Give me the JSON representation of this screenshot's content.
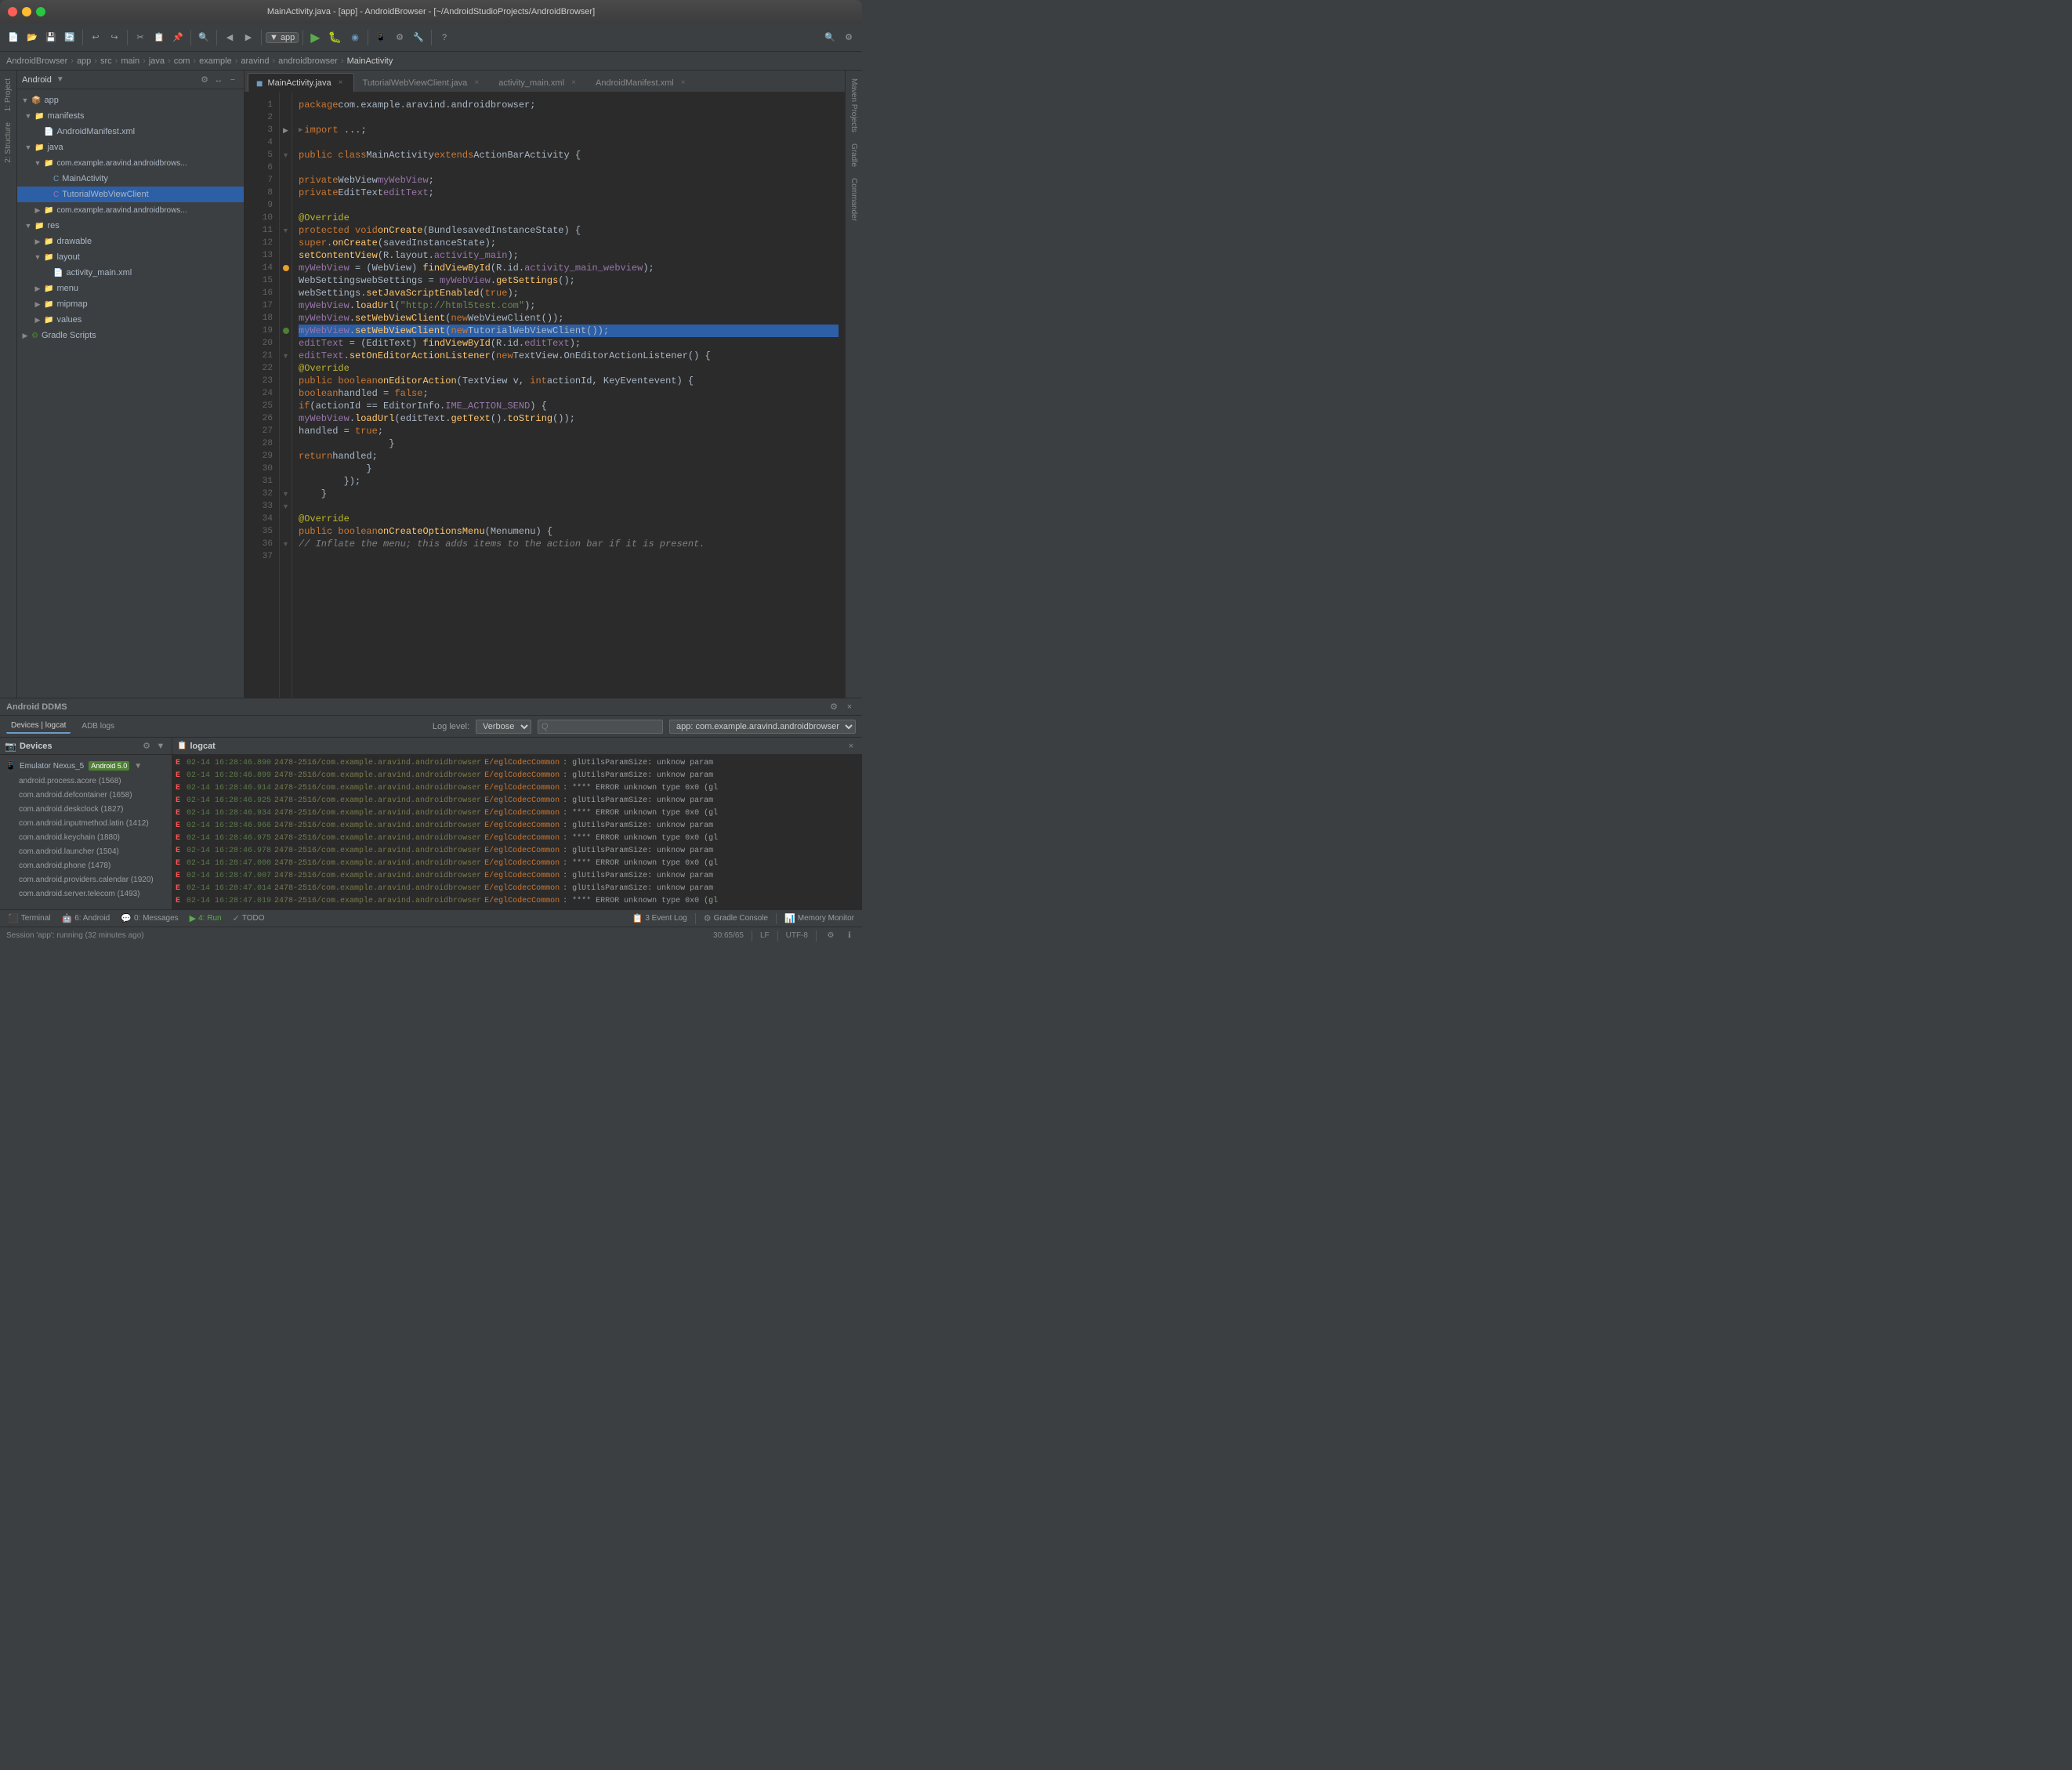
{
  "window": {
    "title": "MainActivity.java - [app] - AndroidBrowser - [~/AndroidStudioProjects/AndroidBrowser]"
  },
  "breadcrumb": {
    "items": [
      "AndroidBrowser",
      "app",
      "src",
      "main",
      "java",
      "com",
      "example",
      "aravind",
      "androidbrowser",
      "MainActivity"
    ]
  },
  "tabs": [
    {
      "label": "MainActivity.java",
      "active": true,
      "modified": true
    },
    {
      "label": "TutorialWebViewClient.java",
      "active": false
    },
    {
      "label": "activity_main.xml",
      "active": false
    },
    {
      "label": "AndroidManifest.xml",
      "active": false
    }
  ],
  "project_panel": {
    "title": "Android",
    "items": [
      {
        "level": 0,
        "label": "app",
        "type": "folder",
        "expanded": true
      },
      {
        "level": 1,
        "label": "manifests",
        "type": "folder",
        "expanded": true
      },
      {
        "level": 2,
        "label": "AndroidManifest.xml",
        "type": "xml"
      },
      {
        "level": 1,
        "label": "java",
        "type": "folder",
        "expanded": true
      },
      {
        "level": 2,
        "label": "com.example.aravind.androidbrows...",
        "type": "folder",
        "expanded": true
      },
      {
        "level": 3,
        "label": "MainActivity",
        "type": "java",
        "selected": false
      },
      {
        "level": 3,
        "label": "TutorialWebViewClient",
        "type": "java_c",
        "selected": true
      },
      {
        "level": 2,
        "label": "com.example.aravind.androidbrows...",
        "type": "folder"
      },
      {
        "level": 1,
        "label": "res",
        "type": "folder",
        "expanded": true
      },
      {
        "level": 2,
        "label": "drawable",
        "type": "folder"
      },
      {
        "level": 2,
        "label": "layout",
        "type": "folder",
        "expanded": true
      },
      {
        "level": 3,
        "label": "activity_main.xml",
        "type": "xml"
      },
      {
        "level": 2,
        "label": "menu",
        "type": "folder"
      },
      {
        "level": 2,
        "label": "mipmap",
        "type": "folder"
      },
      {
        "level": 2,
        "label": "values",
        "type": "folder"
      },
      {
        "level": 0,
        "label": "Gradle Scripts",
        "type": "gradle"
      }
    ]
  },
  "code": {
    "lines": [
      {
        "num": "",
        "content": "package com.example.aravind.androidbrowser;"
      },
      {
        "num": "",
        "content": ""
      },
      {
        "num": "",
        "content": "import ...;"
      },
      {
        "num": "",
        "content": ""
      },
      {
        "num": "",
        "content": "public class MainActivity extends ActionBarActivity {"
      },
      {
        "num": "",
        "content": ""
      },
      {
        "num": "",
        "content": "    private WebView myWebView;"
      },
      {
        "num": "",
        "content": "    private EditText editText;"
      },
      {
        "num": "",
        "content": ""
      },
      {
        "num": "",
        "content": "    @Override"
      },
      {
        "num": "",
        "content": "    protected void onCreate(Bundle savedInstanceState) {"
      },
      {
        "num": "",
        "content": "        super.onCreate(savedInstanceState);"
      },
      {
        "num": "",
        "content": "        setContentView(R.layout.activity_main);"
      },
      {
        "num": "",
        "content": "        myWebView = (WebView) findViewById(R.id.activity_main_webview);"
      },
      {
        "num": "",
        "content": "        WebSettings webSettings = myWebView.getSettings();"
      },
      {
        "num": "",
        "content": "        webSettings.setJavaScriptEnabled(true);"
      },
      {
        "num": "",
        "content": "        myWebView.loadUrl(\"http://html5test.com\");"
      },
      {
        "num": "",
        "content": "        myWebView.setWebViewClient(new WebViewClient());"
      },
      {
        "num": "",
        "content": "        myWebView.setWebViewClient(new TutorialWebViewClient());",
        "highlighted": true
      },
      {
        "num": "",
        "content": "        editText = (EditText) findViewById(R.id.editText);"
      },
      {
        "num": "",
        "content": "        editText.setOnEditorActionListener(new TextView.OnEditorActionListener() {"
      },
      {
        "num": "",
        "content": "            @Override"
      },
      {
        "num": "",
        "content": "            public boolean onEditorAction(TextView v, int actionId, KeyEvent event) {"
      },
      {
        "num": "",
        "content": "                boolean handled = false;"
      },
      {
        "num": "",
        "content": "                if(actionId == EditorInfo.IME_ACTION_SEND) {"
      },
      {
        "num": "",
        "content": "                    myWebView.loadUrl(editText.getText().toString());"
      },
      {
        "num": "",
        "content": "                    handled = true;"
      },
      {
        "num": "",
        "content": "                }"
      },
      {
        "num": "",
        "content": "                return handled;"
      },
      {
        "num": "",
        "content": "            }"
      },
      {
        "num": "",
        "content": "        });"
      },
      {
        "num": "",
        "content": "    }"
      },
      {
        "num": "",
        "content": ""
      },
      {
        "num": "",
        "content": "    @Override"
      },
      {
        "num": "",
        "content": "    public boolean onCreateOptionsMenu(Menu menu) {"
      },
      {
        "num": "",
        "content": "        // Inflate the menu; this adds items to the action bar if it is present."
      }
    ]
  },
  "ddms": {
    "title": "Android DDMS"
  },
  "ddms_toolbar": {
    "tabs": [
      "Devices | logcat",
      "ADB logs"
    ],
    "log_level_label": "Log level:",
    "log_level_value": "Verbose",
    "search_placeholder": "Q",
    "app_filter": "app: com.example.aravind.androidbrowser"
  },
  "devices": {
    "title": "Devices",
    "items": [
      {
        "label": "Emulator Nexus_5 Android 5.0",
        "type": "emulator",
        "badge": "Android 5.0"
      }
    ],
    "processes": [
      {
        "label": "android.process.acore (1568)"
      },
      {
        "label": "com.android.defcontainer (1658)"
      },
      {
        "label": "com.android.deskclock (1827)"
      },
      {
        "label": "com.android.inputmethod.latin (1412)"
      },
      {
        "label": "com.android.keychain (1880)"
      },
      {
        "label": "com.android.launcher (1504)"
      },
      {
        "label": "com.android.phone (1478)"
      },
      {
        "label": "com.android.providers.calendar (1920)"
      },
      {
        "label": "com.android.server.telecom (1493)"
      }
    ]
  },
  "logcat": {
    "title": "logcat",
    "entries": [
      {
        "time": "02-14 16:28:46.890",
        "pid": "2478-2516",
        "pkg": "com.example.aravind.androidbrowser",
        "level": "E",
        "tag": "eglCodecCommon",
        "msg": "glUtilsParamSize: unknow param"
      },
      {
        "time": "02-14 16:28:46.899",
        "pid": "2478-2516",
        "pkg": "com.example.aravind.androidbrowser",
        "level": "E",
        "tag": "eglCodecCommon",
        "msg": "glUtilsParamSize: unknow param"
      },
      {
        "time": "02-14 16:28:46.914",
        "pid": "2478-2516",
        "pkg": "com.example.aravind.androidbrowser",
        "level": "E",
        "tag": "eglCodecCommon",
        "msg": "**** ERROR unknown type 0x0 (gl"
      },
      {
        "time": "02-14 16:28:46.925",
        "pid": "2478-2516",
        "pkg": "com.example.aravind.androidbrowser",
        "level": "E",
        "tag": "eglCodecCommon",
        "msg": "glUtilsParamSize: unknow param"
      },
      {
        "time": "02-14 16:28:46.934",
        "pid": "2478-2516",
        "pkg": "com.example.aravind.androidbrowser",
        "level": "E",
        "tag": "eglCodecCommon",
        "msg": "**** ERROR unknown type 0x0 (gl"
      },
      {
        "time": "02-14 16:28:46.966",
        "pid": "2478-2516",
        "pkg": "com.example.aravind.androidbrowser",
        "level": "E",
        "tag": "eglCodecCommon",
        "msg": "glUtilsParamSize: unknow param"
      },
      {
        "time": "02-14 16:28:46.975",
        "pid": "2478-2516",
        "pkg": "com.example.aravind.androidbrowser",
        "level": "E",
        "tag": "eglCodecCommon",
        "msg": "**** ERROR unknown type 0x0 (gl"
      },
      {
        "time": "02-14 16:28:46.978",
        "pid": "2478-2516",
        "pkg": "com.example.aravind.androidbrowser",
        "level": "E",
        "tag": "eglCodecCommon",
        "msg": "glUtilsParamSize: unknow param"
      },
      {
        "time": "02-14 16:28:47.000",
        "pid": "2478-2516",
        "pkg": "com.example.aravind.androidbrowser",
        "level": "E",
        "tag": "eglCodecCommon",
        "msg": "**** ERROR unknown type 0x0 (gl"
      },
      {
        "time": "02-14 16:28:47.007",
        "pid": "2478-2516",
        "pkg": "com.example.aravind.androidbrowser",
        "level": "E",
        "tag": "eglCodecCommon",
        "msg": "glUtilsParamSize: unknow param"
      },
      {
        "time": "02-14 16:28:47.014",
        "pid": "2478-2516",
        "pkg": "com.example.aravind.androidbrowser",
        "level": "E",
        "tag": "eglCodecCommon",
        "msg": "glUtilsParamSize: unknow param"
      },
      {
        "time": "02-14 16:28:47.019",
        "pid": "2478-2516",
        "pkg": "com.example.aravind.androidbrowser",
        "level": "E",
        "tag": "eglCodecCommon",
        "msg": "**** ERROR unknown type 0x0 (gl"
      }
    ]
  },
  "bottom_tools": [
    {
      "label": "Terminal",
      "icon": ">_",
      "color": "terminal"
    },
    {
      "label": "6: Android",
      "icon": "📱",
      "color": "normal"
    },
    {
      "label": "0: Messages",
      "icon": "💬",
      "color": "normal"
    },
    {
      "label": "4: Run",
      "icon": "▶",
      "color": "run"
    },
    {
      "label": "TODO",
      "icon": "✓",
      "color": "normal"
    },
    {
      "label": "3 Event Log",
      "icon": "📋",
      "color": "normal",
      "right": false
    },
    {
      "label": "Gradle Console",
      "icon": "⚙",
      "color": "normal",
      "right": true
    },
    {
      "label": "Memory Monitor",
      "icon": "📊",
      "color": "normal",
      "right": true
    }
  ],
  "status_bar": {
    "session": "Session 'app': running (32 minutes ago)",
    "position": "30:65/65",
    "line_sep": "LF",
    "encoding": "UTF-8"
  },
  "sidebar_right": {
    "tabs": [
      "Maven Projects",
      "Gradle",
      "Commander"
    ]
  }
}
